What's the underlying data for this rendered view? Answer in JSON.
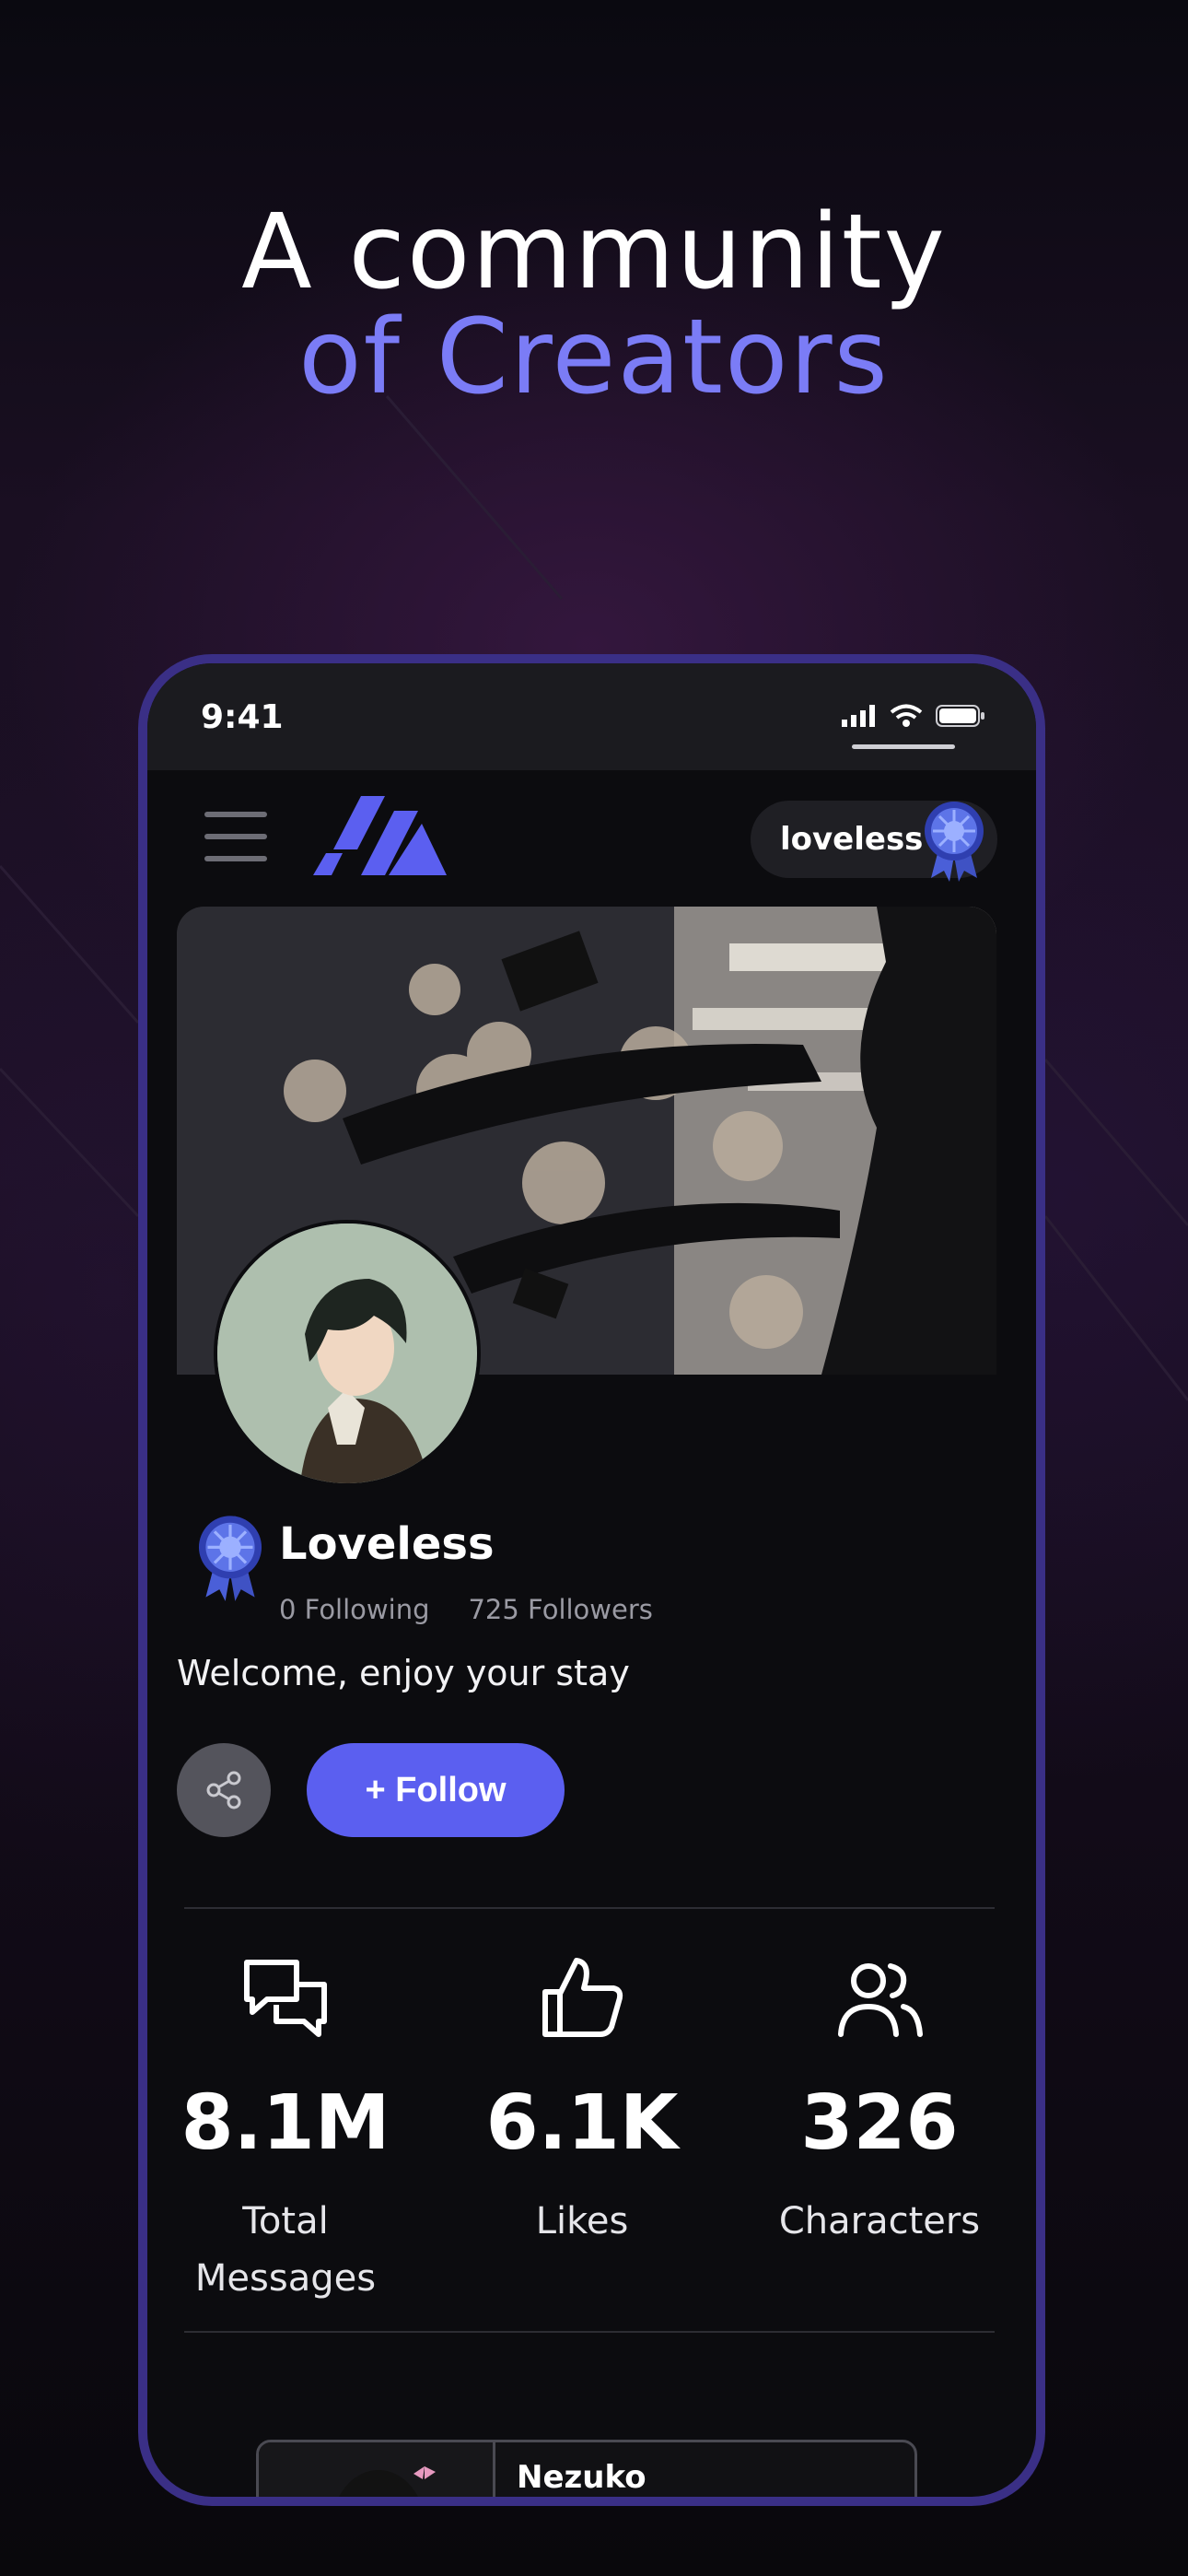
{
  "headline": {
    "line1": "A community",
    "line2": "of Creators"
  },
  "status_bar": {
    "time": "9:41"
  },
  "top_bar": {
    "username": "loveless"
  },
  "profile": {
    "name": "Loveless",
    "following": "0 Following",
    "followers": "725 Followers",
    "bio": "Welcome, enjoy your stay",
    "follow_label": "+ Follow"
  },
  "stats": [
    {
      "icon": "chat-bubbles-icon",
      "value": "8.1M",
      "label": "Total Messages"
    },
    {
      "icon": "thumbs-up-icon",
      "value": "6.1K",
      "label": "Likes"
    },
    {
      "icon": "users-icon",
      "value": "326",
      "label": "Characters"
    }
  ],
  "character_card": {
    "name": "Nezuko"
  },
  "colors": {
    "accent": "#5b5ff0",
    "headline_accent": "#7b7cf6",
    "phone_frame": "#3a2f86"
  }
}
